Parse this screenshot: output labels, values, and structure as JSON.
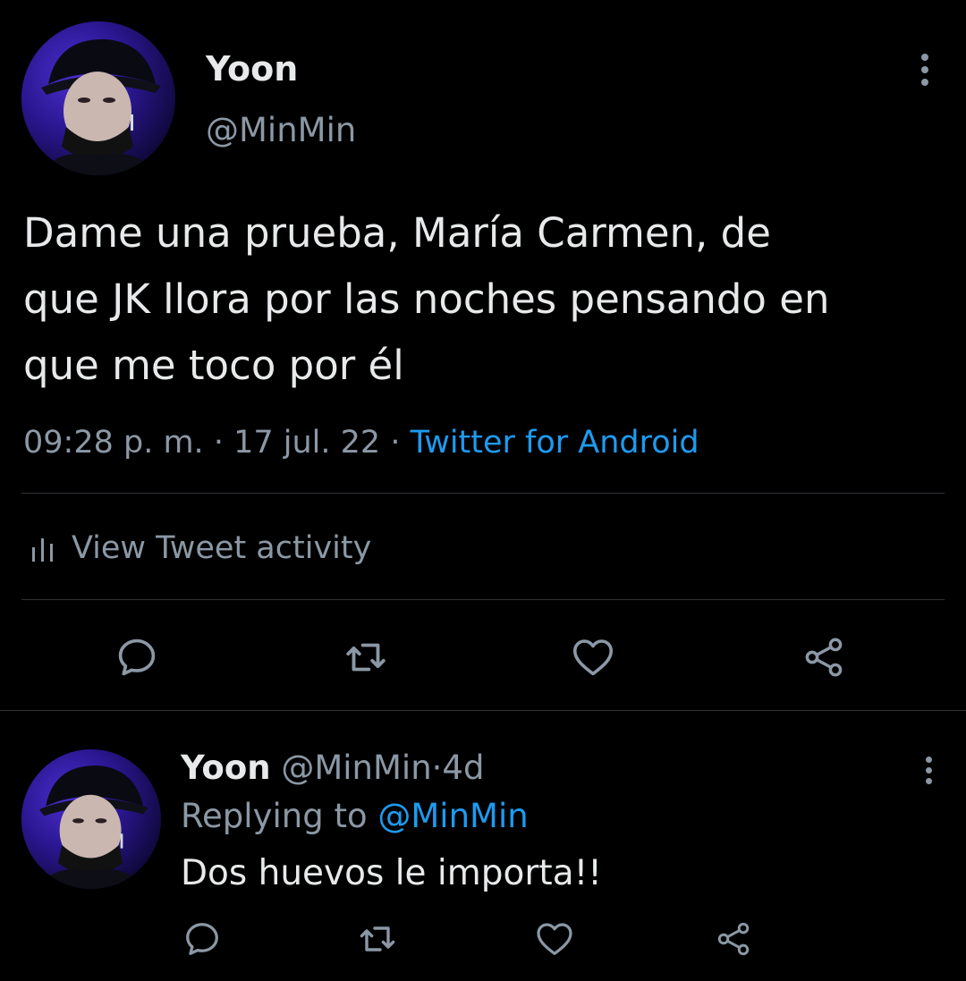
{
  "main_tweet": {
    "author_name": "Yoon",
    "author_handle": "@MinMin",
    "text": "Dame una prueba, María Carmen, de\nque JK llora por las noches pensando en\nque me toco por él",
    "time": "09:28 p. m.",
    "separator": "·",
    "date": "17 jul. 22",
    "source": "Twitter for Android",
    "activity_label": "View Tweet activity",
    "actions": [
      "reply-icon",
      "retweet-icon",
      "like-icon",
      "share-icon"
    ]
  },
  "reply_tweet": {
    "author_name": "Yoon",
    "author_handle": "@MinMin",
    "separator": "·",
    "age": "4d",
    "replying_prefix": "Replying to",
    "replying_handle": "@MinMin",
    "text": "Dos huevos le importa!!",
    "actions": [
      "reply-icon",
      "retweet-icon",
      "like-icon",
      "share-icon"
    ]
  },
  "colors": {
    "background": "#000000",
    "text_primary": "#e7e9ea",
    "text_secondary": "#8b98a5",
    "link": "#1d9bf0",
    "divider": "#2f3336"
  }
}
